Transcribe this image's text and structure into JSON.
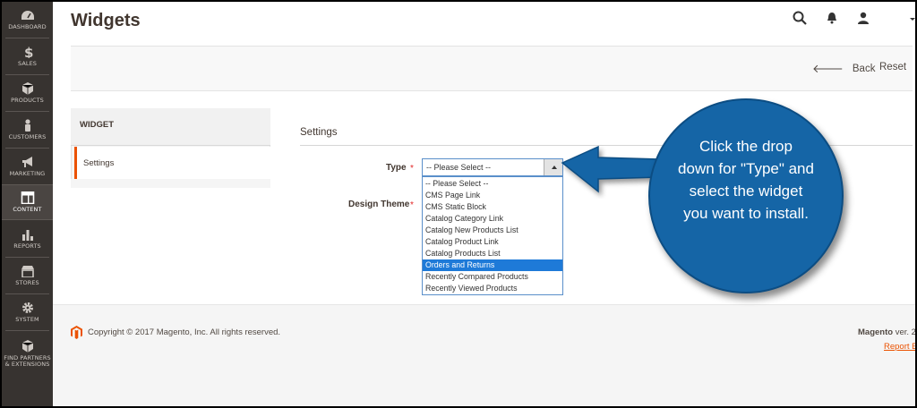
{
  "sidebar": {
    "items": [
      {
        "label": "DASHBOARD",
        "icon": "dashboard-icon"
      },
      {
        "label": "SALES",
        "icon": "dollar-icon"
      },
      {
        "label": "PRODUCTS",
        "icon": "cube-icon"
      },
      {
        "label": "CUSTOMERS",
        "icon": "person-icon"
      },
      {
        "label": "MARKETING",
        "icon": "megaphone-icon"
      },
      {
        "label": "CONTENT",
        "icon": "layout-icon"
      },
      {
        "label": "REPORTS",
        "icon": "bar-chart-icon"
      },
      {
        "label": "STORES",
        "icon": "store-icon"
      },
      {
        "label": "SYSTEM",
        "icon": "gear-icon"
      },
      {
        "label": "FIND PARTNERS & EXTENSIONS",
        "icon": "box-icon"
      }
    ],
    "active": "CONTENT"
  },
  "header": {
    "title": "Widgets",
    "icons": [
      "search-icon",
      "bell-icon",
      "user-icon"
    ]
  },
  "actions": {
    "back_label": "Back",
    "back_arrow": "🡐",
    "reset_label": "Reset"
  },
  "tabs": {
    "heading": "WIDGET",
    "items": [
      {
        "label": "Settings",
        "active": true
      }
    ]
  },
  "form": {
    "section_title": "Settings",
    "type_label": "Type",
    "design_theme_label": "Design Theme",
    "required_mark": "*",
    "type_value": "-- Please Select --",
    "type_options": [
      "-- Please Select --",
      "CMS Page Link",
      "CMS Static Block",
      "Catalog Category Link",
      "Catalog New Products List",
      "Catalog Product Link",
      "Catalog Products List",
      "Orders and Returns",
      "Recently Compared Products",
      "Recently Viewed Products"
    ],
    "highlighted_option": "Orders and Returns"
  },
  "footer": {
    "copyright": "Copyright © 2017 Magento, Inc. All rights reserved.",
    "brand": "Magento",
    "version": "ver. 2",
    "report_link": "Report B"
  },
  "callout": {
    "lines": [
      "Click the drop",
      "down for \"Type\" and",
      "select the widget",
      "you want to install."
    ]
  },
  "colors": {
    "sidebar_bg": "#373330",
    "accent": "#eb5202",
    "callout_bg": "#1565a6",
    "selected_option_bg": "#1e7ad8"
  }
}
